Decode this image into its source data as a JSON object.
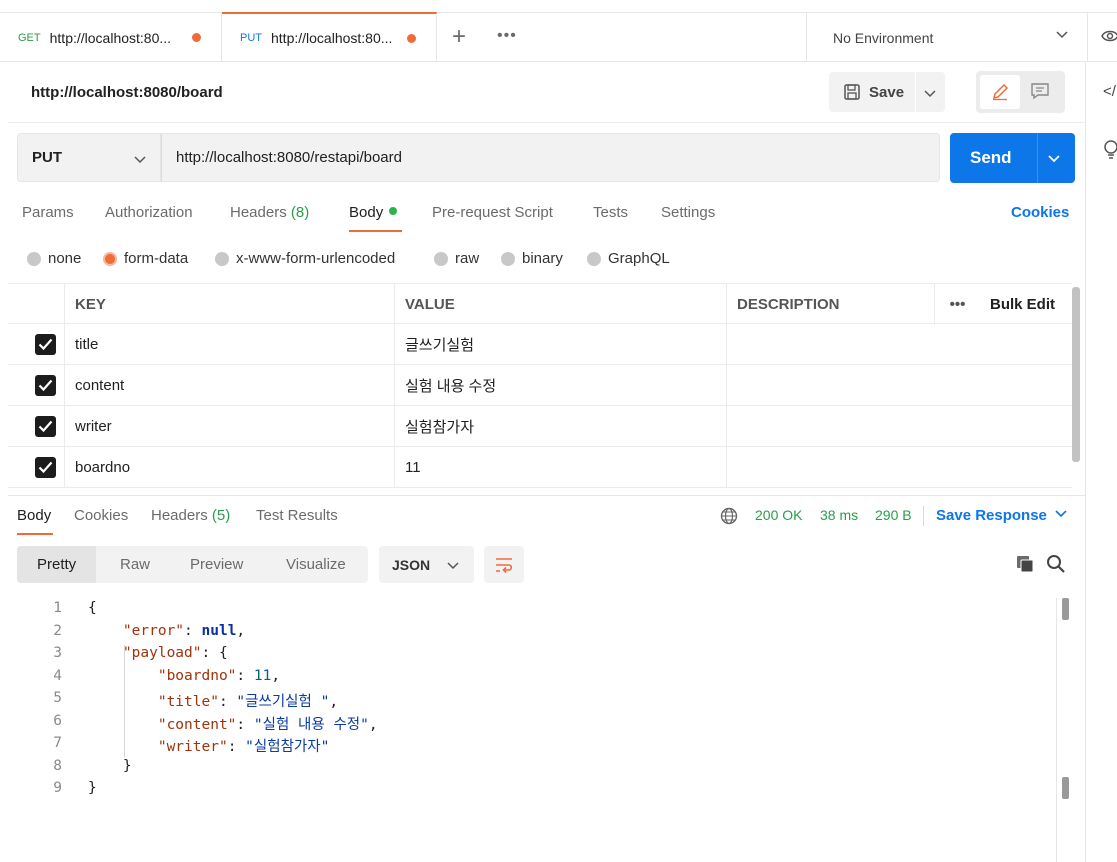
{
  "tabs": [
    {
      "method": "GET",
      "method_color": "#2a9d4a",
      "url": "http://localhost:80..."
    },
    {
      "method": "PUT",
      "method_color": "#0d76e8",
      "url": "http://localhost:80..."
    }
  ],
  "environment": {
    "label": "No Environment"
  },
  "request": {
    "title": "http://localhost:8080/board",
    "save_label": "Save",
    "method": "PUT",
    "url": "http://localhost:8080/restapi/board",
    "send_label": "Send"
  },
  "request_tabs": {
    "params": "Params",
    "authorization": "Authorization",
    "headers": "Headers",
    "headers_count": "(8)",
    "body": "Body",
    "prerequest": "Pre-request Script",
    "tests": "Tests",
    "settings": "Settings",
    "cookies": "Cookies"
  },
  "body_types": {
    "none": "none",
    "form_data": "form-data",
    "urlencoded": "x-www-form-urlencoded",
    "raw": "raw",
    "binary": "binary",
    "graphql": "GraphQL",
    "selected": "form-data"
  },
  "kv_table": {
    "headers": {
      "key": "KEY",
      "value": "VALUE",
      "description": "DESCRIPTION",
      "more": "•••",
      "bulk_edit": "Bulk Edit"
    },
    "rows": [
      {
        "key": "title",
        "value": "글쓰기실험",
        "checked": true
      },
      {
        "key": "content",
        "value": "실험 내용 수정",
        "checked": true
      },
      {
        "key": "writer",
        "value": "실험참가자",
        "checked": true
      },
      {
        "key": "boardno",
        "value": "11",
        "checked": true
      }
    ]
  },
  "response": {
    "tabs": {
      "body": "Body",
      "cookies": "Cookies",
      "headers": "Headers",
      "headers_count": "(5)",
      "test_results": "Test Results"
    },
    "status": "200 OK",
    "time": "38 ms",
    "size": "290 B",
    "save_response": "Save Response",
    "formats": {
      "pretty": "Pretty",
      "raw": "Raw",
      "preview": "Preview",
      "visualize": "Visualize"
    },
    "language": "JSON",
    "code_lines": [
      "1",
      "2",
      "3",
      "4",
      "5",
      "6",
      "7",
      "8",
      "9"
    ],
    "json": {
      "open": "{",
      "error_key": "\"error\"",
      "error_val": "null",
      "payload_key": "\"payload\"",
      "payload_open": "{",
      "boardno_key": "\"boardno\"",
      "boardno_val": "11",
      "title_key": "\"title\"",
      "title_val": "\"글쓰기실험 \"",
      "content_key": "\"content\"",
      "content_val": "\"실험 내용 수정\"",
      "writer_key": "\"writer\"",
      "writer_val": "\"실험참가자\"",
      "payload_close": "}",
      "close": "}"
    }
  },
  "colors": {
    "accent": "#ef6b3a",
    "primary": "#0d76e8",
    "success": "#2a9d4a"
  }
}
